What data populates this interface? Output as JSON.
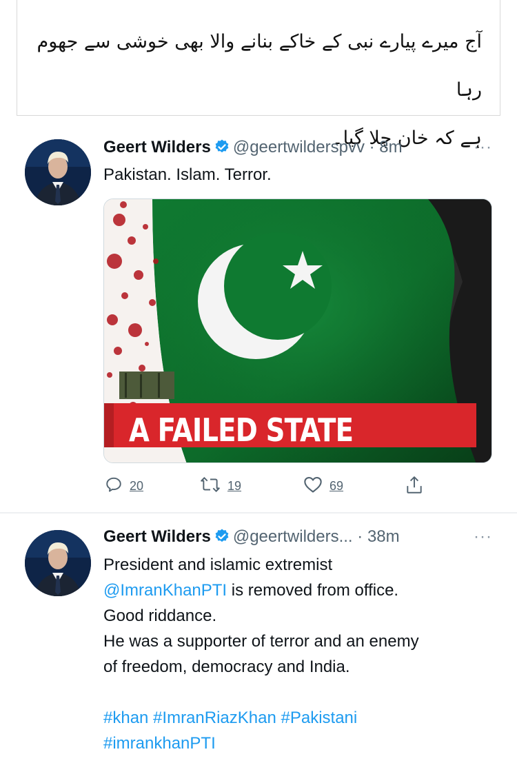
{
  "caption": {
    "line1": "آج میرے پیارے نبی کے خاکے بنانے والا بھی خوشی سے جھوم رہا",
    "line2": "ہے کہ خان چلا گیا۔"
  },
  "tweet1": {
    "author": "Geert Wilders",
    "handle": "@geertwilderspvv",
    "separator": "·",
    "time": "8m",
    "more": "···",
    "text": "Pakistan. Islam. Terror.",
    "image_text": "A FAILED STATE",
    "replies": "20",
    "retweets": "19",
    "likes": "69",
    "icons": [
      "reply-icon",
      "retweet-icon",
      "like-icon",
      "share-icon",
      "verified-badge-icon"
    ]
  },
  "tweet2": {
    "author": "Geert Wilders",
    "handle": "@geertwilders...",
    "separator": "·",
    "time": "38m",
    "more": "···",
    "line1": "President and islamic extremist",
    "mention": "@ImranKhanPTI",
    "line2_rest": " is removed from office.",
    "line3": "Good riddance.",
    "line4": "He was a supporter of terror and an enemy",
    "line5": "of freedom, democracy and India.",
    "hashtags_line1": "#khan #ImranRiazKhan #Pakistani",
    "hashtags_line2": "#imrankhanPTI"
  },
  "colors": {
    "link": "#1d9bf0",
    "verified": "#1d9bf0",
    "muted": "#536471",
    "banner_red": "#d9262b",
    "flag_green": "#0d6b2a"
  }
}
